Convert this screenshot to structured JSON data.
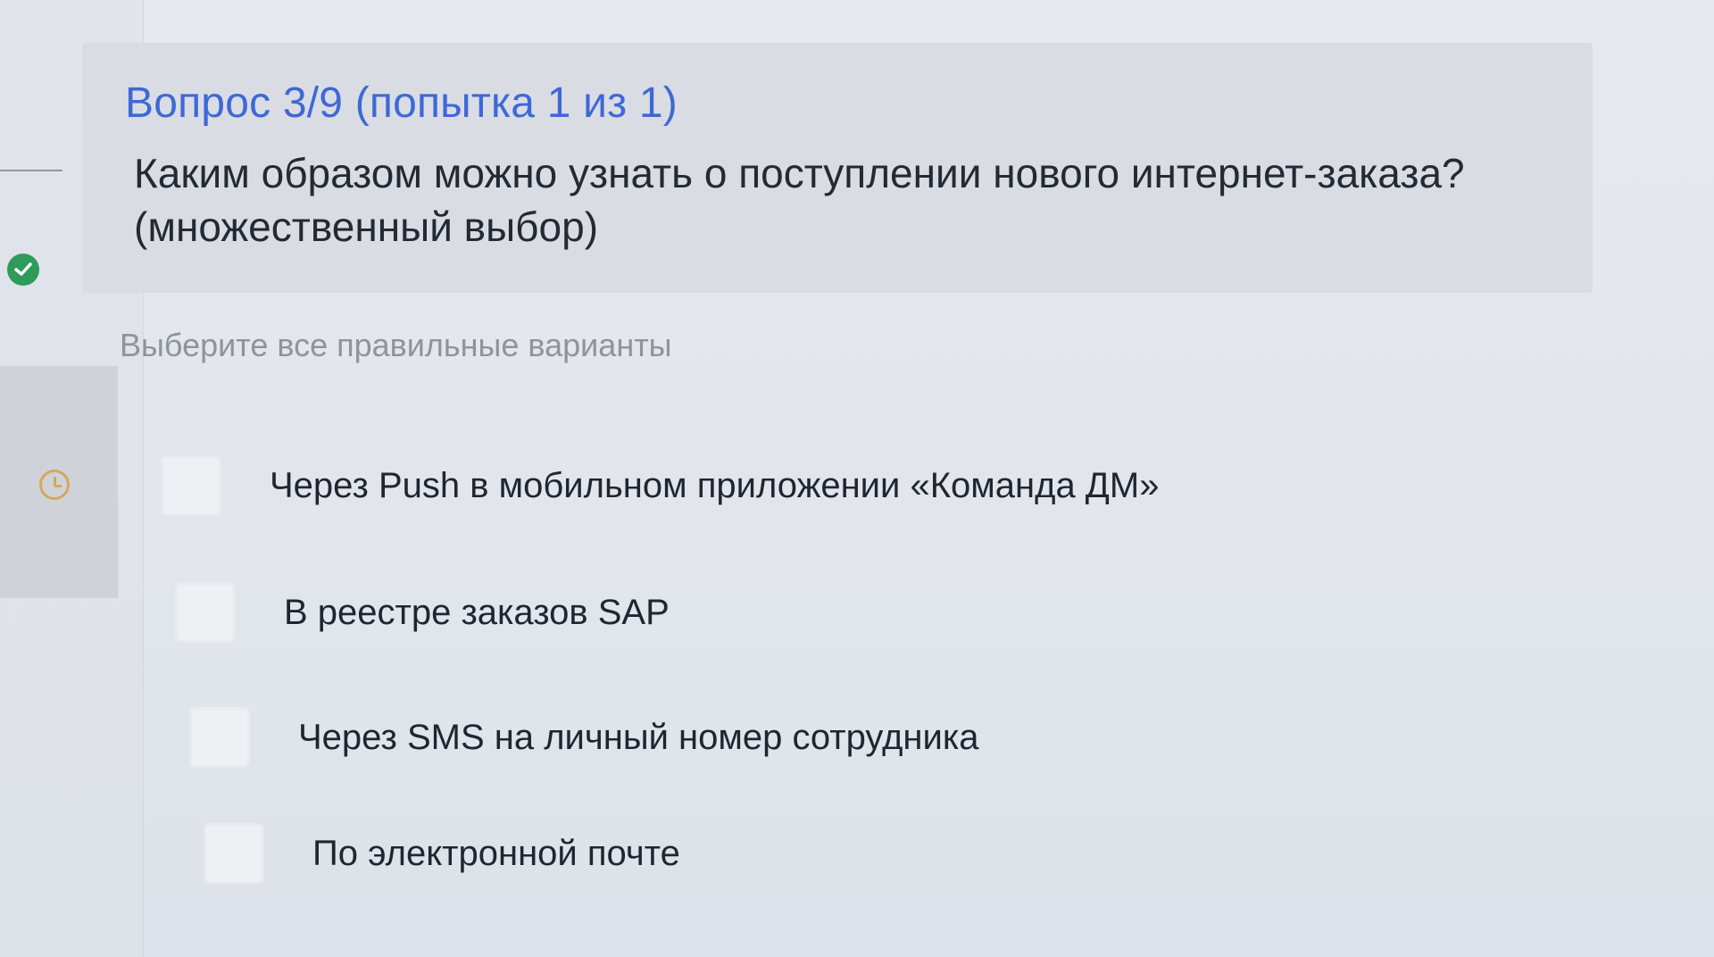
{
  "question": {
    "number_label": "Вопрос 3/9 (попытка 1 из 1)",
    "text": "Каким образом можно узнать о поступлении нового интернет-заказа? (множественный выбор)"
  },
  "instruction": "Выберите все правильные варианты",
  "options": [
    {
      "label": "Через Push в мобильном приложении «Команда ДМ»",
      "checked": false
    },
    {
      "label": "В реестре заказов SAP",
      "checked": false
    },
    {
      "label": "Через SMS на личный номер сотрудника",
      "checked": false
    },
    {
      "label": "По электронной почте",
      "checked": false
    }
  ],
  "sidebar": {
    "icons": [
      "check-icon",
      "clock-icon"
    ],
    "colors": {
      "check": "#2f9b59",
      "clock": "#d8a65a",
      "question_number": "#3f68d6"
    }
  }
}
